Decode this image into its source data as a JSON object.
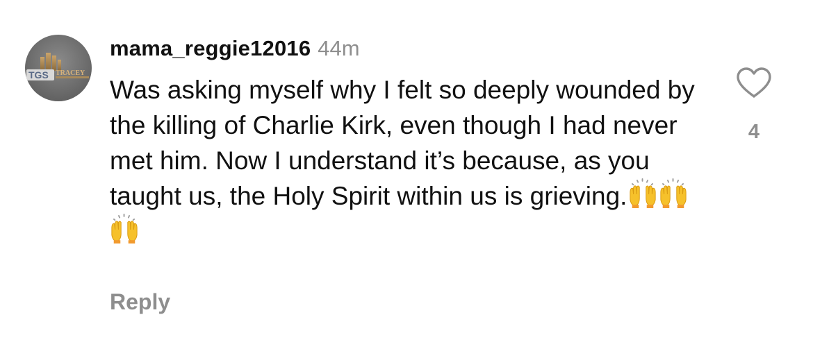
{
  "comment": {
    "username": "mama_reggie12016",
    "time": "44m",
    "text": "Was asking myself why I felt so deeply wounded by the killing of Charlie Kirk, even though I had never met him. Now I understand it’s because, as you taught us, the Holy Spirit within us is grieving.",
    "emojis": [
      "raising-hands-emoji",
      "raising-hands-emoji",
      "raising-hands-emoji"
    ],
    "reply_label": "Reply",
    "like_count": "4",
    "avatar": {
      "logo_text": "TGS",
      "brand_text": "TRACEY"
    }
  },
  "colors": {
    "text": "#111111",
    "muted": "#8e8e8e",
    "emoji_yellow": "#f6c12b"
  }
}
